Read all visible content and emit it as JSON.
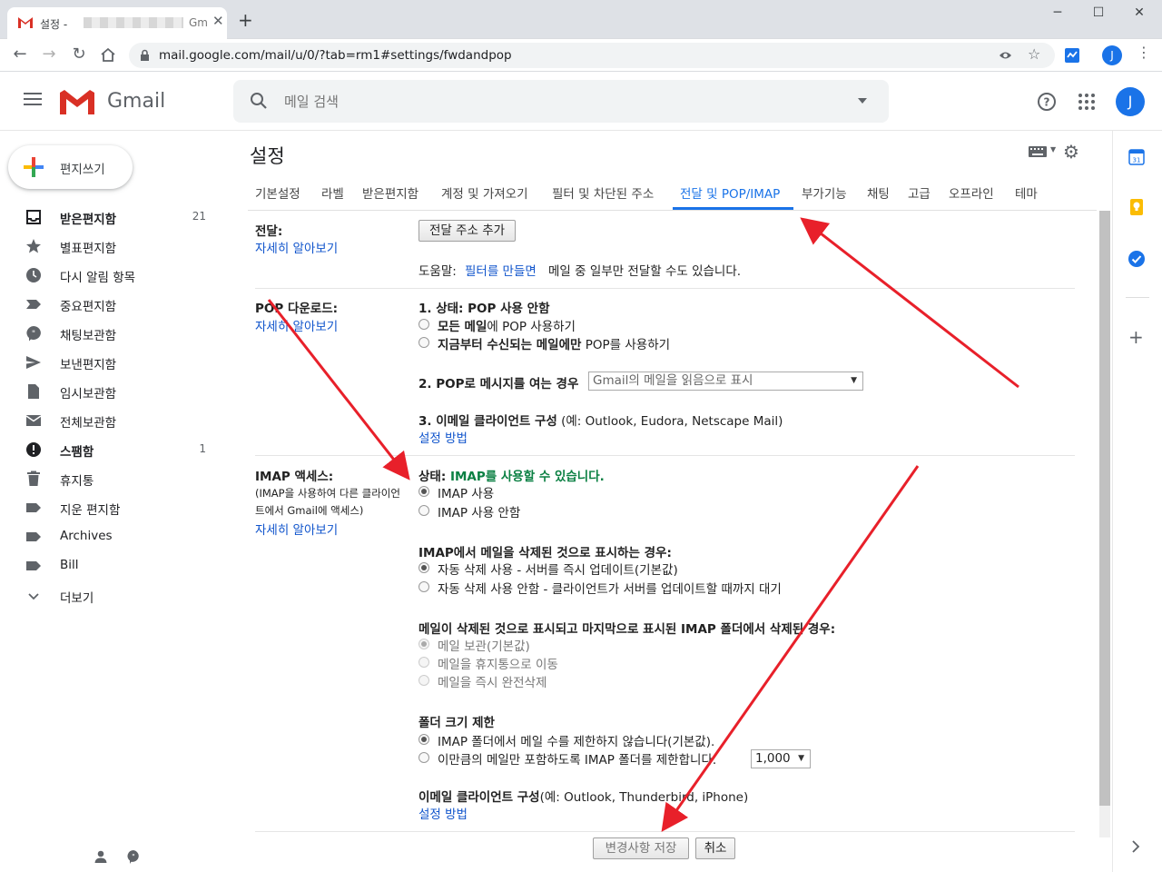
{
  "browser": {
    "tab_title": "설정 -",
    "tab_title_suffix": "Gm",
    "url": "mail.google.com/mail/u/0/?tab=rm1#settings/fwdandpop",
    "profile_initial": "J"
  },
  "header": {
    "brand": "Gmail",
    "search_placeholder": "메일 검색",
    "avatar_initial": "J"
  },
  "sidebar": {
    "compose_label": "편지쓰기",
    "items": [
      {
        "label": "받은편지함",
        "count": "21",
        "bold": true
      },
      {
        "label": "별표편지함",
        "count": ""
      },
      {
        "label": "다시 알림 항목",
        "count": ""
      },
      {
        "label": "중요편지함",
        "count": ""
      },
      {
        "label": "채팅보관함",
        "count": ""
      },
      {
        "label": "보낸편지함",
        "count": ""
      },
      {
        "label": "임시보관함",
        "count": ""
      },
      {
        "label": "전체보관함",
        "count": ""
      },
      {
        "label": "스팸함",
        "count": "1",
        "bold": true
      },
      {
        "label": "휴지통",
        "count": ""
      },
      {
        "label": "지운 편지함",
        "count": ""
      },
      {
        "label": "Archives",
        "count": ""
      },
      {
        "label": "Bill",
        "count": ""
      },
      {
        "label": "더보기",
        "count": ""
      }
    ]
  },
  "settings": {
    "title": "설정",
    "tabs": [
      "기본설정",
      "라벨",
      "받은편지함",
      "계정 및 가져오기",
      "필터 및 차단된 주소",
      "전달 및 POP/IMAP",
      "부가기능",
      "채팅",
      "고급",
      "오프라인",
      "테마"
    ],
    "learn_more": "자세히 알아보기",
    "forwarding": {
      "title": "전달:",
      "add_button": "전달 주소 추가",
      "tip_prefix": "도움말:",
      "tip_link": "필터를 만들면",
      "tip_suffix": "메일 중 일부만 전달할 수도 있습니다."
    },
    "pop": {
      "title": "POP 다운로드:",
      "status_label": "1. 상태: POP 사용 안함",
      "option_all_bold": "모든 메일",
      "option_all_rest": "에 POP 사용하기",
      "option_new_bold": "지금부터 수신되는 메일에만",
      "option_new_rest": "POP를 사용하기",
      "when_accessed_label": "2. POP로 메시지를 여는 경우",
      "when_accessed_value": "Gmail의 메일을 읽음으로 표시",
      "client_label": "3. 이메일 클라이언트 구성",
      "client_example": "(예: Outlook, Eudora, Netscape Mail)",
      "setup_link": "설정 방법"
    },
    "imap": {
      "title": "IMAP 액세스:",
      "note_line1": "(IMAP을 사용하여 다른 클라이언",
      "note_line2": "트에서 Gmail에 액세스)",
      "status_prefix": "상태:",
      "status_value": "IMAP를 사용할 수 있습니다.",
      "enable_label": "IMAP 사용",
      "disable_label": "IMAP 사용 안함",
      "deleted_heading": "IMAP에서 메일을 삭제된 것으로 표시하는 경우:",
      "auto_expunge_on": "자동 삭제 사용 - 서버를 즉시 업데이트(기본값)",
      "auto_expunge_off": "자동 삭제 사용 안함 - 클라이언트가 서버를 업데이트할 때까지 대기",
      "expunged_heading": "메일이 삭제된 것으로 표시되고 마지막으로 표시된 IMAP 폴더에서 삭제된 경우:",
      "archive_label": "메일 보관(기본값)",
      "trash_label": "메일을 휴지통으로 이동",
      "delete_label": "메일을 즉시 완전삭제",
      "folder_limit_heading": "폴더 크기 제한",
      "no_limit_label": "IMAP 폴더에서 메일 수를 제한하지 않습니다(기본값).",
      "limit_label": "이만큼의 메일만 포함하도록 IMAP 폴더를 제한합니다.",
      "limit_value": "1,000",
      "client_label": "이메일 클라이언트 구성",
      "client_example": "(예: Outlook, Thunderbird, iPhone)",
      "setup_link": "설정 방법"
    },
    "save_button": "변경사항 저장",
    "cancel_button": "취소"
  },
  "colors": {
    "accent": "#1a73e8",
    "link": "#1155cc",
    "status_green": "#0b8043",
    "arrow_red": "#e8202a"
  }
}
